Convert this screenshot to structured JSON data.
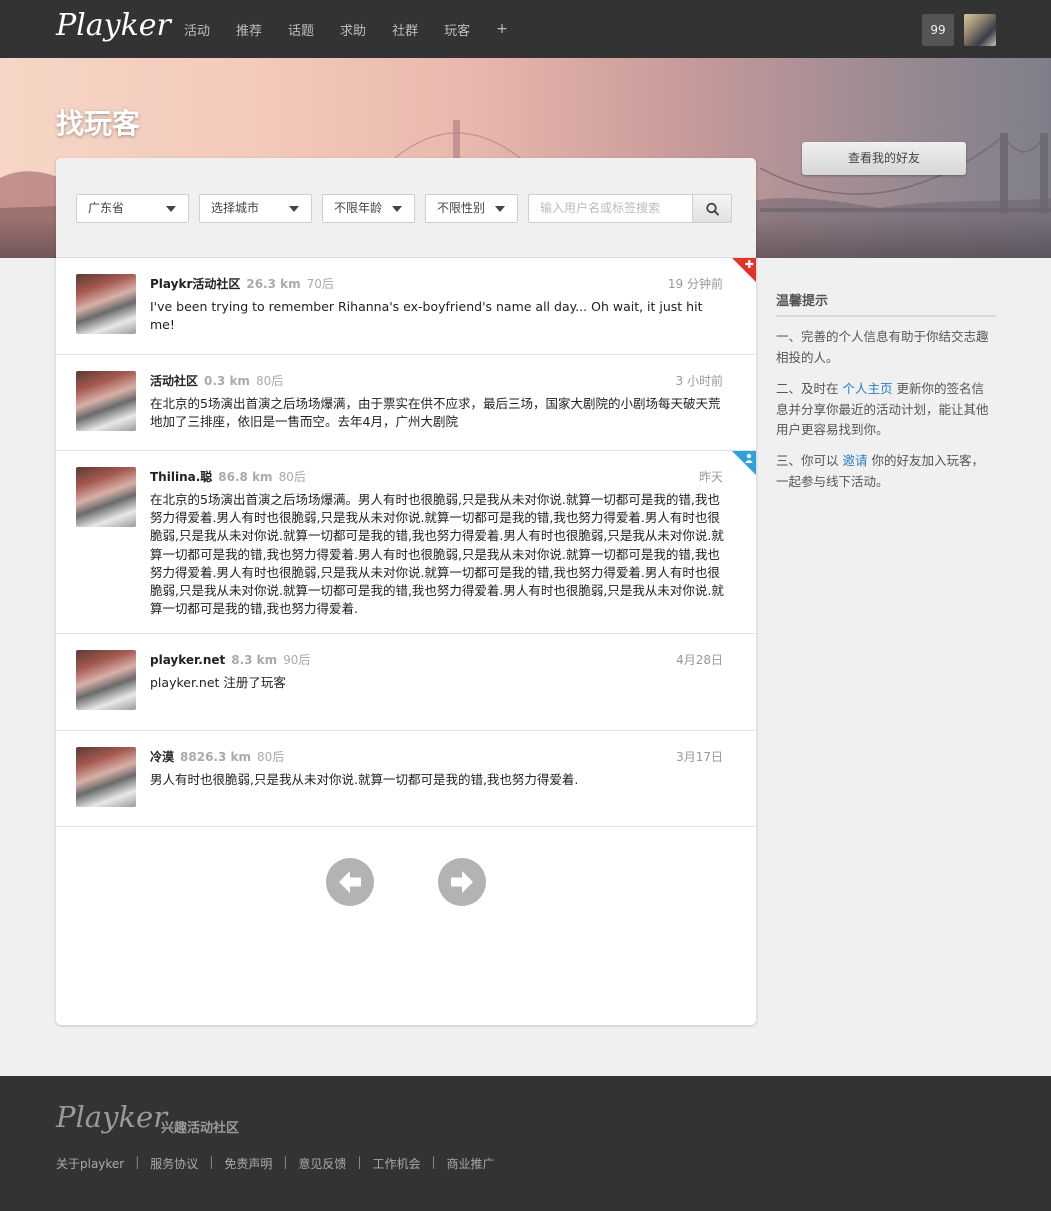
{
  "topbar": {
    "logo": "Playker",
    "nav": [
      "活动",
      "推荐",
      "话题",
      "求助",
      "社群",
      "玩客"
    ],
    "plus": "+",
    "notification_count": "99"
  },
  "banner": {
    "title": "找玩客",
    "friends_button": "查看我的好友"
  },
  "filters": {
    "province": "广东省",
    "city": "选择城市",
    "age": "不限年龄",
    "gender": "不限性别",
    "search_placeholder": "输入用户名或标签搜索"
  },
  "feed": [
    {
      "name": "Playkr活动社区",
      "distance": "26.3 km",
      "age": "70后",
      "time": "19 分钟前",
      "text": "I've been trying to remember Rihanna's ex-boyfriend's name all day... Oh wait, it just hit me!",
      "badge": "plus"
    },
    {
      "name": "活动社区",
      "distance": "0.3 km",
      "age": "80后",
      "time": "3 小时前",
      "text": "在北京的5场演出首演之后场场爆满，由于票实在供不应求，最后三场，国家大剧院的小剧场每天破天荒地加了三排座，依旧是一售而空。去年4月，广州大剧院",
      "badge": ""
    },
    {
      "name": "Thilina.聪",
      "distance": "86.8 km",
      "age": "80后",
      "time": "昨天",
      "text": "在北京的5场演出首演之后场场爆满。男人有时也很脆弱,只是我从未对你说.就算一切都可是我的错,我也努力得爱着.男人有时也很脆弱,只是我从未对你说.就算一切都可是我的错,我也努力得爱着.男人有时也很脆弱,只是我从未对你说.就算一切都可是我的错,我也努力得爱着.男人有时也很脆弱,只是我从未对你说.就算一切都可是我的错,我也努力得爱着.男人有时也很脆弱,只是我从未对你说.就算一切都可是我的错,我也努力得爱着.男人有时也很脆弱,只是我从未对你说.就算一切都可是我的错,我也努力得爱着.男人有时也很脆弱,只是我从未对你说.就算一切都可是我的错,我也努力得爱着.男人有时也很脆弱,只是我从未对你说.就算一切都可是我的错,我也努力得爱着.",
      "badge": "person"
    },
    {
      "name": "playker.net",
      "distance": "8.3 km",
      "age": "90后",
      "time": "4月28日",
      "text": "playker.net 注册了玩客",
      "badge": ""
    },
    {
      "name": "冷漠",
      "distance": "8826.3 km",
      "age": "80后",
      "time": "3月17日",
      "text": "男人有时也很脆弱,只是我从未对你说.就算一切都可是我的错,我也努力得爱着.",
      "badge": ""
    }
  ],
  "pager": {
    "prev_icon": "arrow-left-icon",
    "next_icon": "arrow-right-icon"
  },
  "tips": {
    "title": "温馨提示",
    "tip1": "一、完善的个人信息有助于你结交志趣相投的人。",
    "tip2_before": "二、及时在 ",
    "tip2_link": "个人主页",
    "tip2_after": " 更新你的签名信息并分享你最近的活动计划，能让其他用户更容易找到你。",
    "tip3_before": "三、你可以 ",
    "tip3_link": "邀请",
    "tip3_after": " 你的好友加入玩客，一起参与线下活动。"
  },
  "footer": {
    "logo": "Playker",
    "slogan": "兴趣活动社区",
    "links": [
      "关于playker",
      "服务协议",
      "免责声明",
      "意见反馈",
      "工作机会",
      "商业推广"
    ],
    "separator": "|"
  },
  "colors": {
    "topbar": "#333333",
    "link": "#2a7fc0",
    "badge_red": "#e0332c",
    "badge_blue": "#2aa3dc"
  }
}
